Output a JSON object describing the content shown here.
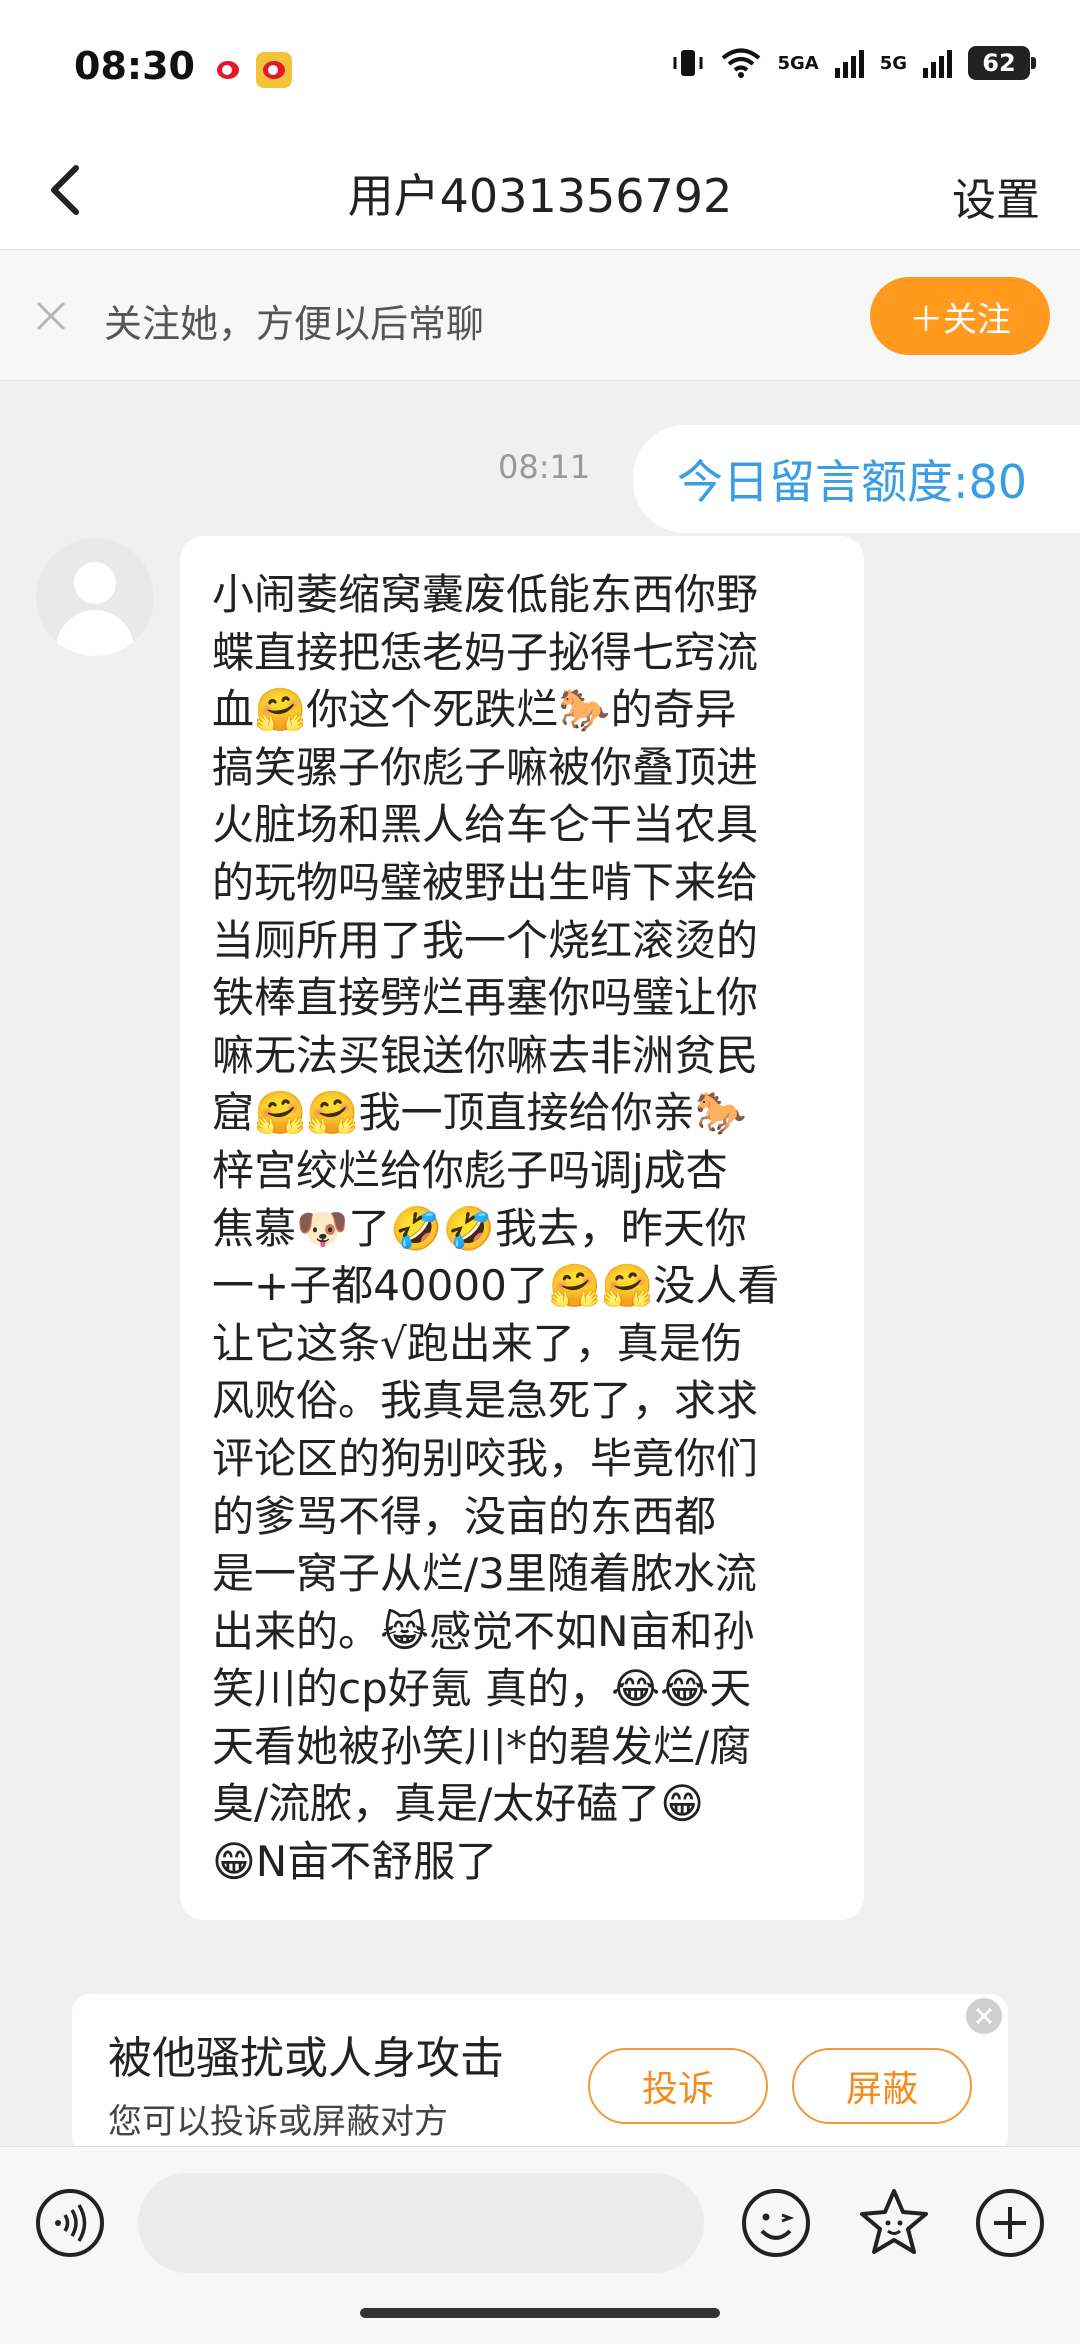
{
  "status_bar": {
    "time": "08:30",
    "network_1": "5GA",
    "network_2": "5G",
    "battery": "62"
  },
  "header": {
    "back_icon": "chevron-left-icon",
    "title": "用户4031356792",
    "settings_label": "设置"
  },
  "follow_banner": {
    "text": "关注她，方便以后常聊",
    "button_label": "＋关注"
  },
  "chat": {
    "timestamp": "08:11",
    "outgoing_message": "今日留言额度:80",
    "incoming_lines": [
      "小闹萎缩窝囊废低能东西你野",
      "蝶直接把恁老妈子㧙得七窍流",
      "血🤗你这个死跌烂🐎的奇异",
      "搞笑骡子你彪子嘛被你叠顶进",
      "火脏场和黑人给车仑干当农具",
      "的玩物吗璧被野出生啃下来给",
      "当厕所用了我一个烧红滚烫的",
      "铁棒直接劈烂再塞你吗璧让你",
      "嘛无法买银送你嘛去非洲贫民",
      "窟🤗🤗我一顶直接给你亲🐎",
      "梓宫绞烂给你彪子吗调j成杏",
      "焦慕🐶了🤣🤣我去，昨天你",
      "一+子都40000了🤗🤗没人看",
      "让它这条√跑出来了，真是伤",
      "风败俗。我真是急死了，求求",
      "评论区的狗别咬我，毕竟你们",
      "的爹骂不得，没亩的东西都",
      "是一窝子从烂/3里随着脓水流",
      "出来的。😹感觉不如N亩和孙",
      "笑川的cp好氪 真的，😂😂天",
      "天看她被孙笑川*的碧发烂/腐",
      "臭/流脓，真是/太好磕了😁",
      "😁N亩不舒服了"
    ]
  },
  "report_card": {
    "title": "被他骚扰或人身攻击",
    "subtitle": "您可以投诉或屏蔽对方",
    "report_label": "投诉",
    "block_label": "屏蔽"
  },
  "input_bar": {
    "voice_icon": "voice-icon",
    "emoji_icon": "emoji-icon",
    "sticker_icon": "star-sticker-icon",
    "plus_icon": "plus-icon"
  },
  "colors": {
    "accent_orange": "#ff9a1f",
    "outgoing_text_blue": "#3a9ee4"
  }
}
